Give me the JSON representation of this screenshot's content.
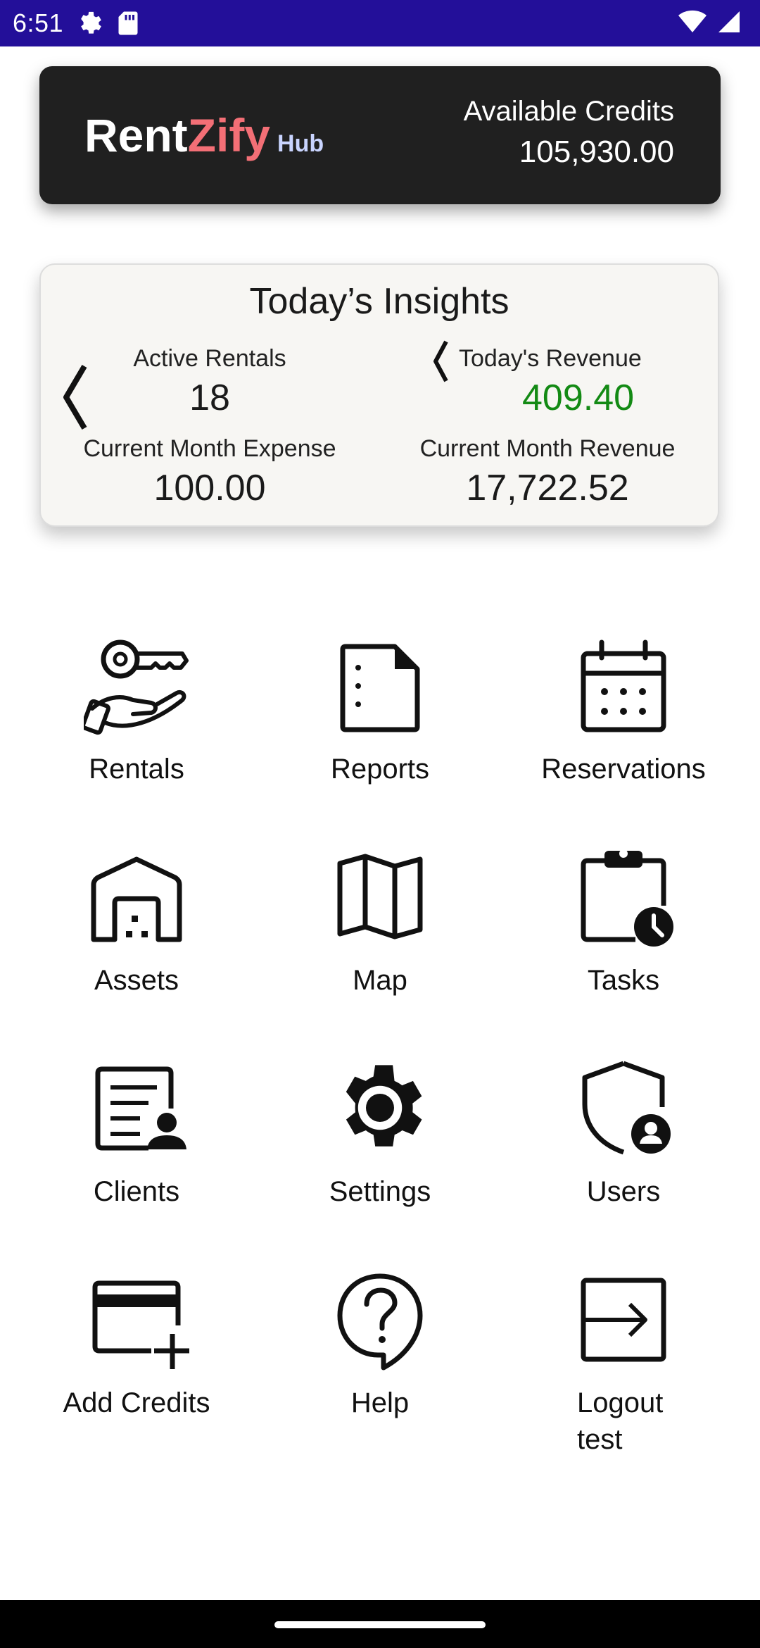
{
  "status_bar": {
    "time": "6:51",
    "icons": [
      "settings-gear-icon",
      "sd-card-icon",
      "wifi-icon",
      "signal-icon"
    ],
    "background_color": "#230f99"
  },
  "header": {
    "logo": {
      "part1": "Rent",
      "part2": "Zify",
      "part3": "Hub"
    },
    "credits_label": "Available Credits",
    "credits_value": "105,930.00"
  },
  "insights": {
    "title": "Today’s Insights",
    "metrics": [
      {
        "label": "Active Rentals",
        "value": "18"
      },
      {
        "label": "Today's Revenue",
        "value": "409.40",
        "color": "#138a14"
      },
      {
        "label": "Current Month Expense",
        "value": "100.00"
      },
      {
        "label": "Current Month Revenue",
        "value": "17,722.52"
      }
    ]
  },
  "menu": [
    {
      "label": "Rentals",
      "icon": "key-hand-icon"
    },
    {
      "label": "Reports",
      "icon": "document-icon"
    },
    {
      "label": "Reservations",
      "icon": "calendar-icon"
    },
    {
      "label": "Assets",
      "icon": "garage-icon"
    },
    {
      "label": "Map",
      "icon": "map-icon"
    },
    {
      "label": "Tasks",
      "icon": "clipboard-clock-icon"
    },
    {
      "label": "Clients",
      "icon": "client-card-icon"
    },
    {
      "label": "Settings",
      "icon": "gear-icon"
    },
    {
      "label": "Users",
      "icon": "shield-user-icon"
    },
    {
      "label": "Add Credits",
      "icon": "credit-card-add-icon"
    },
    {
      "label": "Help",
      "icon": "help-bubble-icon"
    },
    {
      "label": "Logout\ntest",
      "icon": "logout-icon"
    }
  ],
  "colors": {
    "accent_red": "#f36f76",
    "hub_blue": "#c9d4ff",
    "header_bg": "#202020",
    "revenue_green": "#138a14"
  }
}
